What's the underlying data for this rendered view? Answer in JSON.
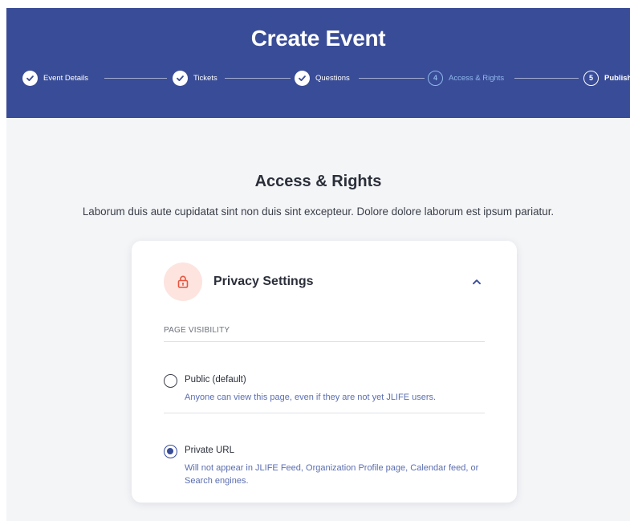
{
  "header": {
    "title": "Create Event",
    "background": "#394c97"
  },
  "stepper": {
    "steps": [
      {
        "label": "Event Details",
        "state": "done",
        "marker": ""
      },
      {
        "label": "Tickets",
        "state": "done",
        "marker": ""
      },
      {
        "label": "Questions",
        "state": "done",
        "marker": ""
      },
      {
        "label": "Access & Rights",
        "state": "current",
        "marker": "4"
      },
      {
        "label": "Publish",
        "state": "upcoming",
        "marker": "5"
      }
    ],
    "current_color": "#8fb8ec"
  },
  "section": {
    "title": "Access & Rights",
    "description": "Laborum duis aute cupidatat sint non duis sint excepteur. Dolore dolore laborum est ipsum pariatur."
  },
  "privacy_card": {
    "title": "Privacy Settings",
    "icon": "lock-icon",
    "accent": "#e8553f",
    "expanded": true,
    "visibility_label": "PAGE VISIBILITY",
    "options": [
      {
        "title": "Public (default)",
        "description": "Anyone can view this page, even if they are not yet JLIFE users.",
        "selected": false
      },
      {
        "title": "Private URL",
        "description": "Will not appear in JLIFE Feed, Organization Profile page, Calendar feed, or Search engines.",
        "selected": true
      }
    ]
  }
}
